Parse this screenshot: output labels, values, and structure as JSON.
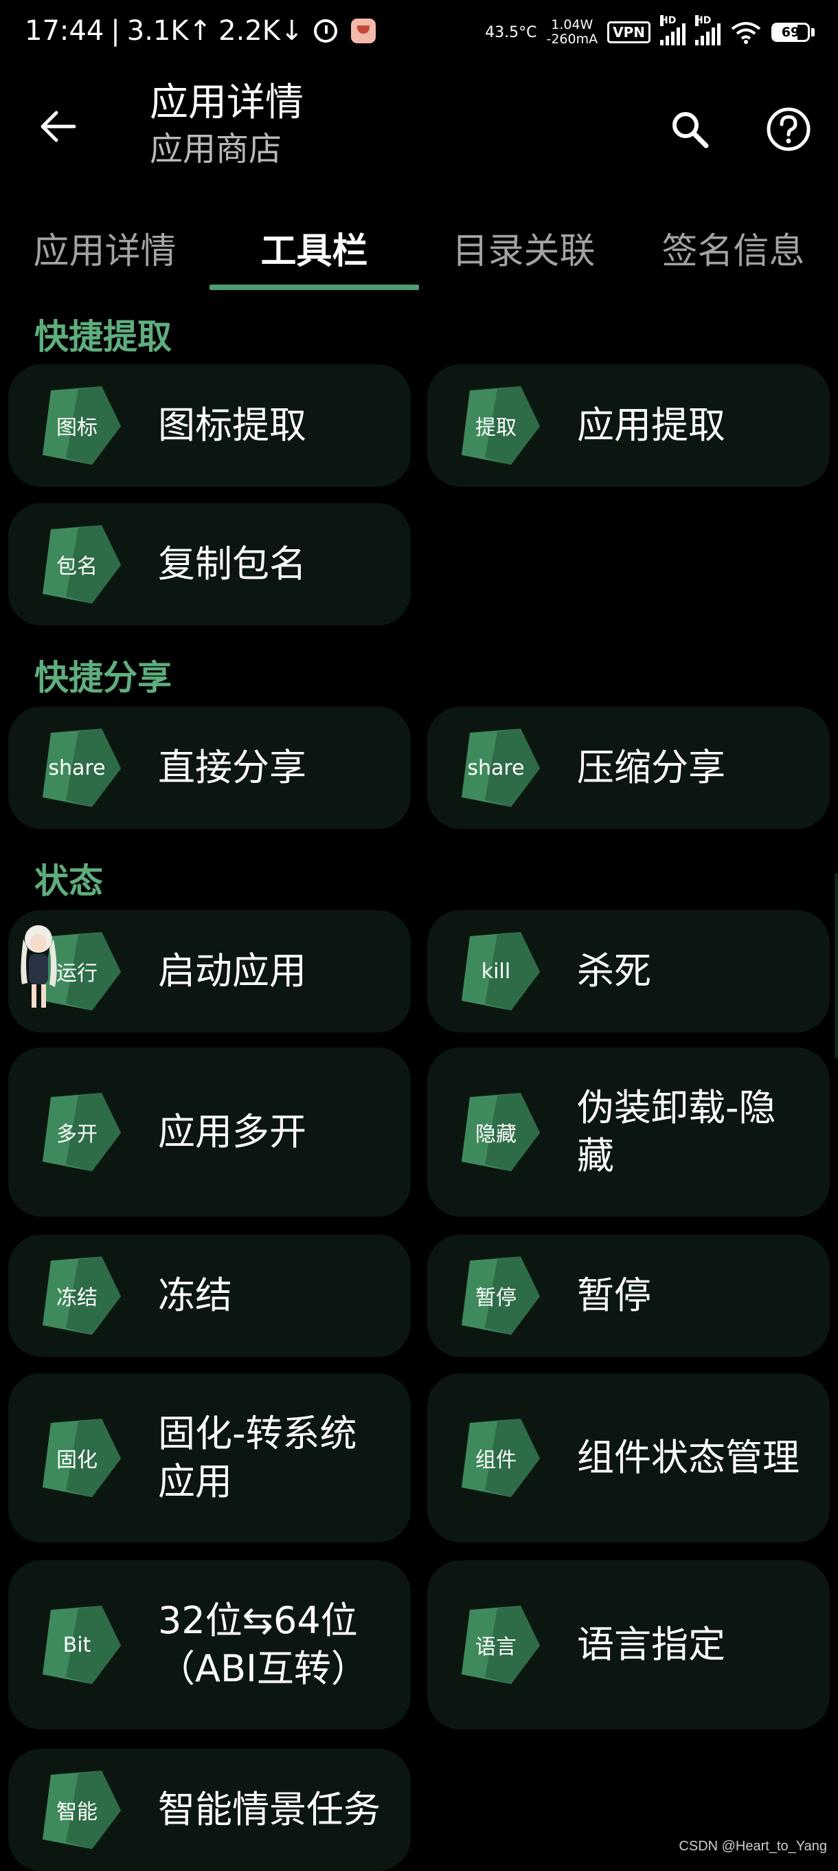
{
  "status_bar": {
    "time": "17:44",
    "up_speed": "3.1K↑",
    "down_speed": "2.2K↓",
    "temperature": "43.5°C",
    "power": "1.04W",
    "current": "-260mA",
    "vpn": "VPN",
    "hd1": "HD",
    "hd2": "HD",
    "battery": "69",
    "battery_level": 0.69,
    "separator": "|"
  },
  "app_bar": {
    "title": "应用详情",
    "subtitle": "应用商店"
  },
  "tabs": [
    {
      "label": "应用详情",
      "active": false
    },
    {
      "label": "工具栏",
      "active": true
    },
    {
      "label": "目录关联",
      "active": false
    },
    {
      "label": "签名信息",
      "active": false
    }
  ],
  "sections": {
    "quick_extract": "快捷提取",
    "quick_share": "快捷分享",
    "state": "状态"
  },
  "cards": {
    "icon_extract": {
      "badge": "图标",
      "label": "图标提取"
    },
    "app_extract": {
      "badge": "提取",
      "label": "应用提取"
    },
    "copy_package": {
      "badge": "包名",
      "label": "复制包名"
    },
    "direct_share": {
      "badge": "share",
      "label": "直接分享"
    },
    "compress_share": {
      "badge": "share",
      "label": "压缩分享"
    },
    "launch_app": {
      "badge": "运行",
      "label": "启动应用"
    },
    "kill_app": {
      "badge": "kill",
      "label": "杀死"
    },
    "multi_open": {
      "badge": "多开",
      "label": "应用多开"
    },
    "fake_uninstall": {
      "badge": "隐藏",
      "label": "伪装卸载-隐藏"
    },
    "freeze": {
      "badge": "冻结",
      "label": "冻结"
    },
    "pause": {
      "badge": "暂停",
      "label": "暂停"
    },
    "solidify": {
      "badge": "固化",
      "label": "固化-转系统应用"
    },
    "component_state": {
      "badge": "组件",
      "label": "组件状态管理"
    },
    "abi_convert": {
      "badge": "Bit",
      "label": "32位⇆64位（ABI互转）"
    },
    "language": {
      "badge": "语言",
      "label": "语言指定"
    },
    "smart_task": {
      "badge": "智能",
      "label": "智能情景任务"
    }
  },
  "watermark": "CSDN @Heart_to_Yang",
  "colors": {
    "accent": "#5fae7e",
    "card_bg": "#0c1611",
    "badge_dark": "#2e6b47",
    "badge_light": "#3f8a5c"
  }
}
